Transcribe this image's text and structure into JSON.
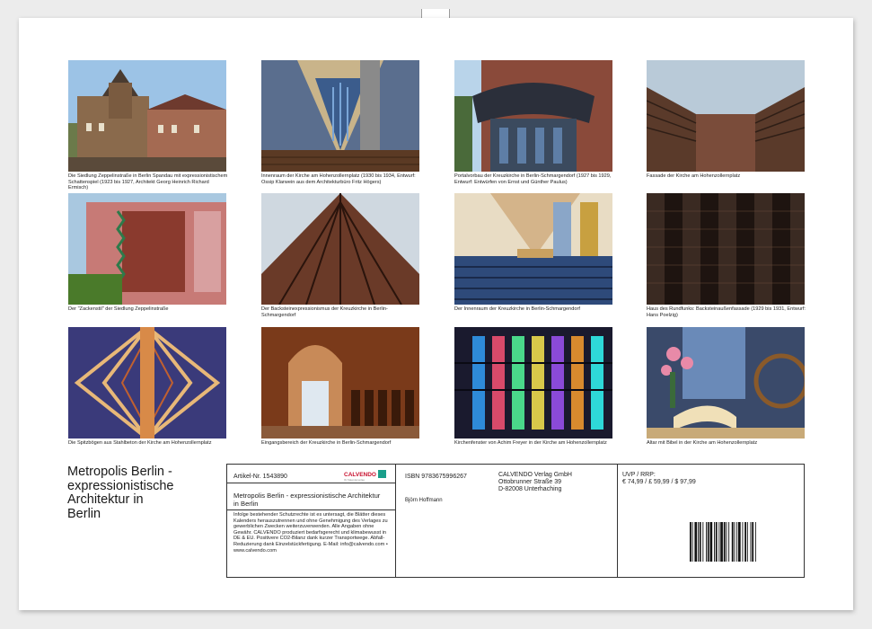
{
  "document": {
    "title_lines": [
      "Metropolis Berlin -",
      "expressionistische",
      "Architektur in",
      "Berlin"
    ]
  },
  "photos": [
    {
      "caption": "Die Siedlung Zeppelinstraße in Berlin Spandau mit expressionistischem Schattenspiel (1923 bis 1927, Architekt Georg Heinrich Richard Ermisch)",
      "icon": "tower-house-photo"
    },
    {
      "caption": "Innenraum der Kirche am Hohenzollernplatz (1930 bis 1934, Entwurf: Ossip Klarwein aus dem Architekturbüro Fritz Högers)",
      "icon": "church-interior-photo"
    },
    {
      "caption": "Portalvorbau der Kreuzkirche in Berlin-Schmargendorf (1927 bis 1929, Entwurf: Entwürfen von Ernst und Günther Paulus)",
      "icon": "portal-photo"
    },
    {
      "caption": "Fassade der Kirche am Hohenzollernplatz",
      "icon": "facade-photo"
    },
    {
      "caption": "Der \"Zackenstil\" der Siedlung Zeppelinstraße",
      "icon": "zigzag-house-photo"
    },
    {
      "caption": "Der Backsteinexpressionismus der Kreuzkirche in Berlin-Schmargendorf",
      "icon": "brick-tower-photo"
    },
    {
      "caption": "Der Innenraum der Kreuzkirche in Berlin-Schmargendorf",
      "icon": "pews-photo"
    },
    {
      "caption": "Haus des Rundfunks: Backsteinaußenfassade (1929 bis 1931, Entwurf: Hans Poelzig)",
      "icon": "brick-facade-photo"
    },
    {
      "caption": "Die Spitzbögen aus Stahlbeton der Kirche am Hohenzollernplatz",
      "icon": "arches-photo"
    },
    {
      "caption": "Eingangsbereich der Kreuzkirche in Berlin-Schmargendorf",
      "icon": "entrance-photo"
    },
    {
      "caption": "Kirchenfenster von Achim Freyer in der Kirche am Hohenzollernplatz",
      "icon": "stained-glass-photo"
    },
    {
      "caption": "Altar mit Bibel in der Kirche am Hohenzollernplatz",
      "icon": "altar-bible-photo"
    }
  ],
  "info": {
    "article_label": "Artikel-Nr. 1543890",
    "brand": "CALVENDO",
    "product_title": "Metropolis Berlin - expressionistische Architektur in Berlin",
    "legal_text": "Infolge bestehender Schutzrechte ist es untersagt, die Blätter dieses Kalenders herauszutrennen und ohne Genehmigung des Verlages zu gewerblichen Zwecken weiterzuverwenden. Alle Angaben ohne Gewähr. CALVENDO produziert bedarfsgerecht und klimabewusst in DE & EU. Positivere CO2-Bilanz dank kurzer Transportwege. Abfall-Reduzierung dank Einzelstückfertigung. E-Mail: info@calvendo.com • www.calvendo.com",
    "isbn": "ISBN 9783675996267",
    "publisher": [
      "CALVENDO Verlag GmbH",
      "Ottobrunner Straße 39",
      "D-82008 Unterhaching"
    ],
    "author": "Björn Hoffmann",
    "price_label": "UVP / RRP:",
    "price_values": "€ 74,99 / £ 59,99 / $ 97,99"
  }
}
